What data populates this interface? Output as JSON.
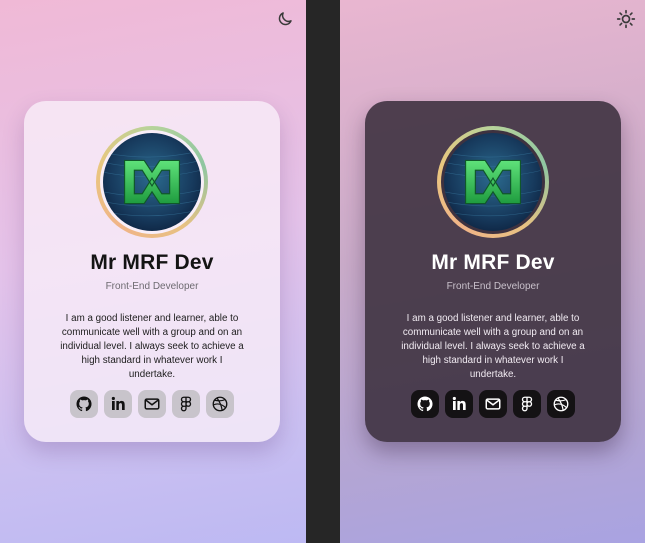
{
  "theme_colors": {
    "light_text": "#141414",
    "dark_text": "#ffffff",
    "ring": [
      "#b6d39b",
      "#f0b488"
    ]
  },
  "light_panel": {
    "toggle_icon": "moon-icon",
    "profile": {
      "name": "Mr MRF Dev",
      "role": "Front-End Developer",
      "bio": "I am a good listener and learner, able to communicate well with a group and on an individual level. I always seek to achieve a high standard in whatever work I undertake."
    },
    "socials": [
      "github-icon",
      "linkedin-icon",
      "mail-icon",
      "figma-icon",
      "dribbble-icon"
    ]
  },
  "dark_panel": {
    "toggle_icon": "sun-icon",
    "profile": {
      "name": "Mr MRF Dev",
      "role": "Front-End Developer",
      "bio": "I am a good listener and learner, able to communicate well with a group and on an individual level. I always seek to achieve a high standard in whatever work I undertake."
    },
    "socials": [
      "github-icon",
      "linkedin-icon",
      "mail-icon",
      "figma-icon",
      "dribbble-icon"
    ]
  }
}
